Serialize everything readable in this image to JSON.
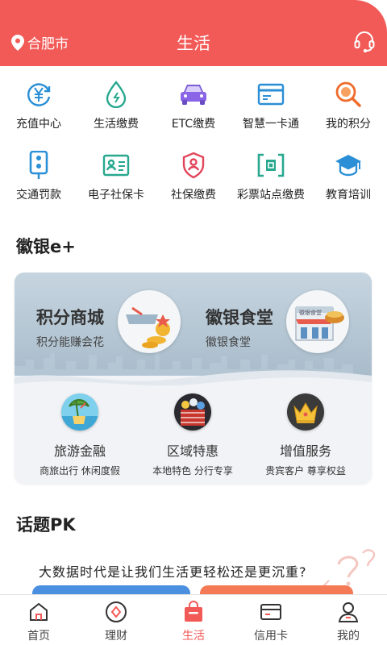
{
  "header": {
    "location": "合肥市",
    "title": "生活",
    "location_icon": "location-pin-icon",
    "service_icon": "headset-icon",
    "bg_color": "#f25a57"
  },
  "services": [
    {
      "label": "充值中心",
      "icon": "yuan-recharge-icon"
    },
    {
      "label": "生活缴费",
      "icon": "water-drop-icon"
    },
    {
      "label": "ETC缴费",
      "icon": "car-icon"
    },
    {
      "label": "智慧一卡通",
      "icon": "card-icon"
    },
    {
      "label": "我的积分",
      "icon": "points-search-icon"
    },
    {
      "label": "交通罚款",
      "icon": "traffic-light-icon"
    },
    {
      "label": "电子社保卡",
      "icon": "id-card-icon"
    },
    {
      "label": "社保缴费",
      "icon": "shield-user-icon"
    },
    {
      "label": "彩票站点缴费",
      "icon": "lottery-icon"
    },
    {
      "label": "教育培训",
      "icon": "graduation-cap-icon"
    }
  ],
  "section_huiyin": {
    "title": "徽银e+",
    "promos": [
      {
        "title": "积分商城",
        "subtitle": "积分能赚会花"
      },
      {
        "title": "徽银食堂",
        "subtitle": "徽银食堂",
        "badge": "徽银食堂"
      }
    ],
    "features": [
      {
        "title": "旅游金融",
        "subtitle": "商旅出行 休闲度假"
      },
      {
        "title": "区域特惠",
        "subtitle": "本地特色 分行专享"
      },
      {
        "title": "增值服务",
        "subtitle": "贵宾客户 尊享权益"
      }
    ]
  },
  "section_topic": {
    "title": "话题PK",
    "question": "大数据时代是让我们生活更轻松还是更沉重?"
  },
  "tabbar": {
    "active_color": "#f25a57",
    "items": [
      {
        "label": "首页",
        "icon": "home-icon"
      },
      {
        "label": "理财",
        "icon": "wealth-icon"
      },
      {
        "label": "生活",
        "icon": "shopping-bag-icon"
      },
      {
        "label": "信用卡",
        "icon": "credit-card-icon"
      },
      {
        "label": "我的",
        "icon": "user-icon"
      }
    ]
  }
}
